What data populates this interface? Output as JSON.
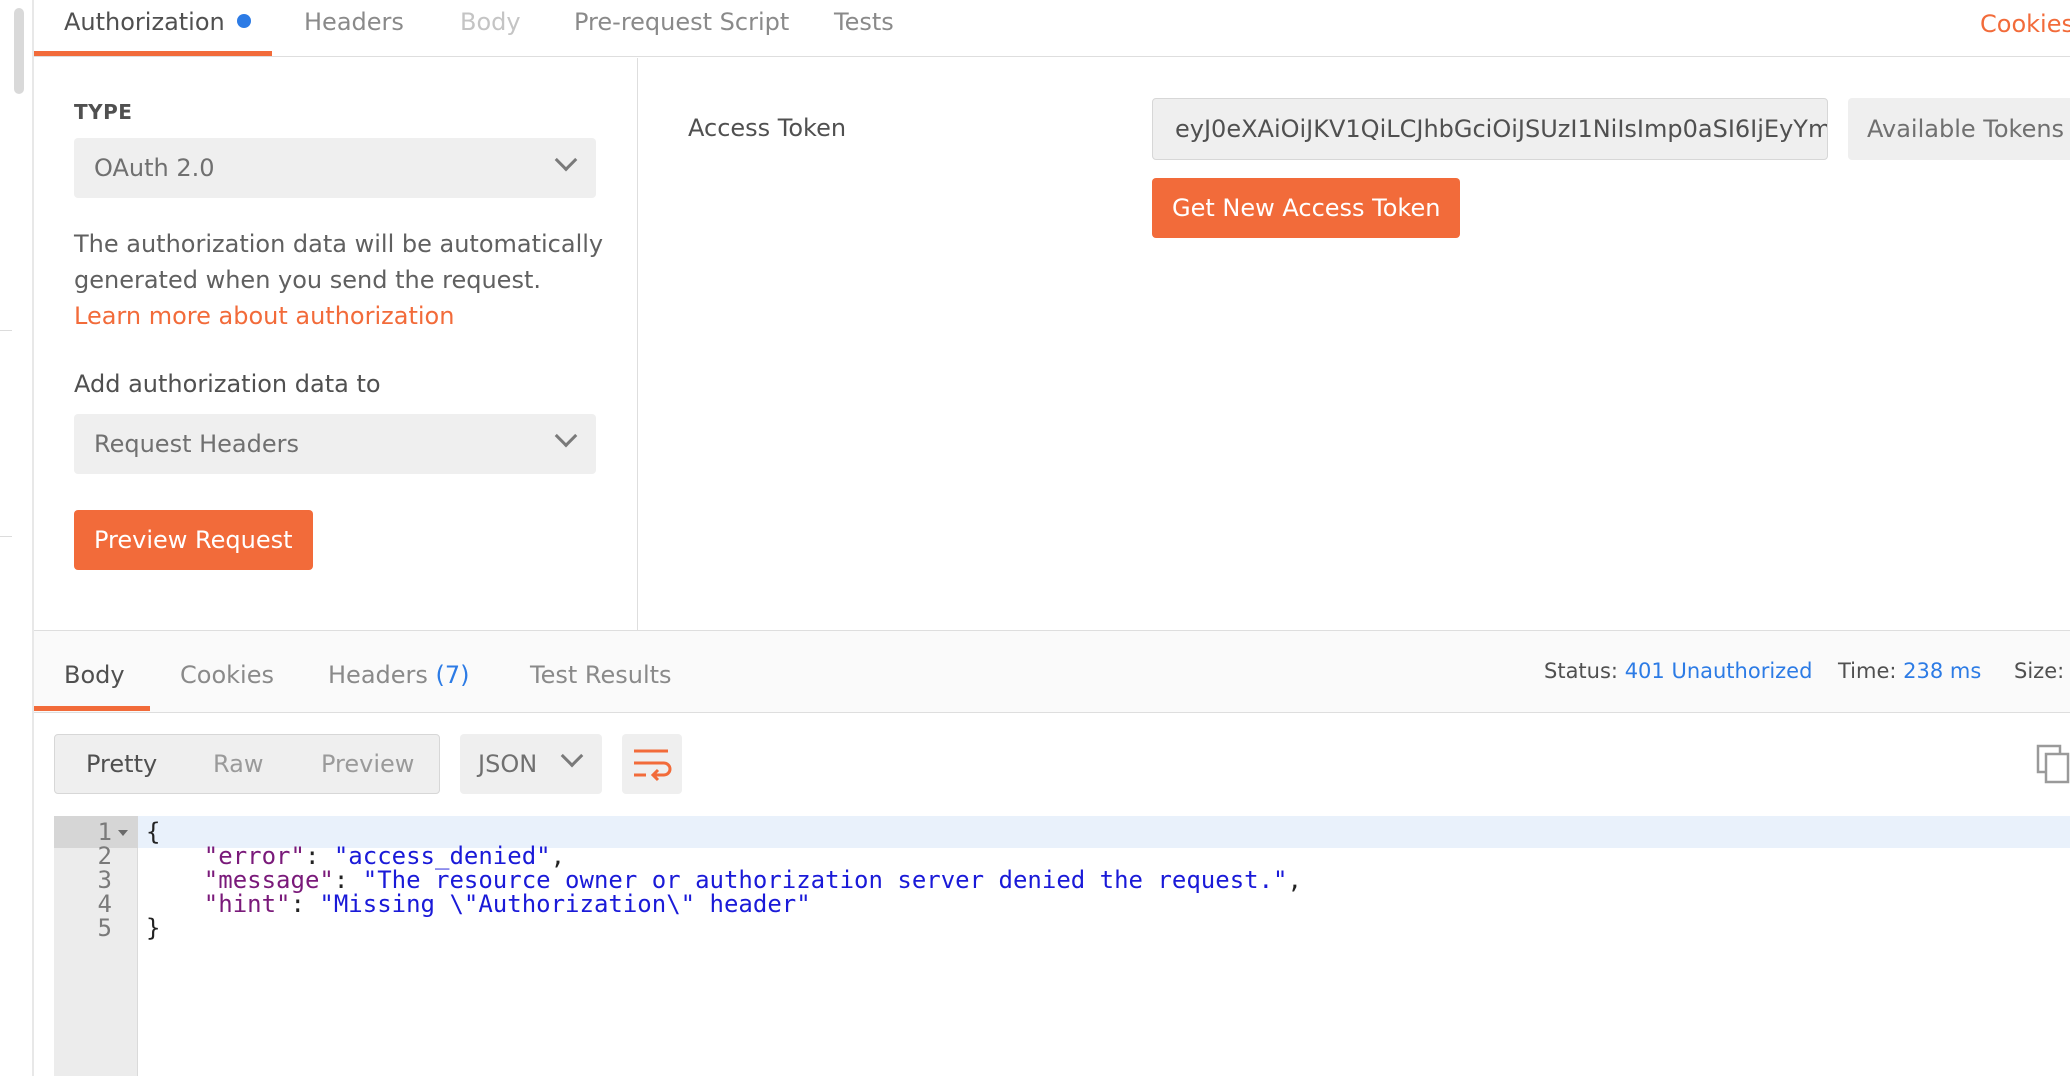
{
  "request_tabs": {
    "authorization": "Authorization",
    "headers": "Headers",
    "body": "Body",
    "pre_request": "Pre-request Script",
    "tests": "Tests",
    "cookies": "Cookies"
  },
  "auth": {
    "type_label": "TYPE",
    "type_value": "OAuth 2.0",
    "description": "The authorization data will be automatically generated when you send the request. ",
    "learn_more": "Learn more about authorization",
    "add_to_label": "Add authorization data to",
    "add_to_value": "Request Headers",
    "preview_button": "Preview Request",
    "access_token_label": "Access Token",
    "access_token_value": "eyJ0eXAiOiJKV1QiLCJhbGciOiJSUzI1NiIsImp0aSI6IjEyYm...",
    "available_tokens": "Available Tokens",
    "get_new_token": "Get New Access Token"
  },
  "response_tabs": {
    "body": "Body",
    "cookies": "Cookies",
    "headers": "Headers",
    "headers_count": "(7)",
    "test_results": "Test Results"
  },
  "status": {
    "status_label": "Status:",
    "status_value": "401 Unauthorized",
    "time_label": "Time:",
    "time_value": "238 ms",
    "size_label": "Size:"
  },
  "view": {
    "pretty": "Pretty",
    "raw": "Raw",
    "preview": "Preview",
    "format": "JSON"
  },
  "code": {
    "line_numbers": [
      "1",
      "2",
      "3",
      "4",
      "5"
    ],
    "open_brace": "{",
    "close_brace": "}",
    "error_key": "\"error\"",
    "error_value": "\"access_denied\"",
    "message_key": "\"message\"",
    "message_value": "\"The resource owner or authorization server denied the request.\"",
    "hint_key": "\"hint\"",
    "hint_value": "\"Missing \\\"Authorization\\\" header\""
  },
  "colors": {
    "accent": "#f26b3a",
    "link_blue": "#2c7be5",
    "json_key": "#7a1a7a",
    "json_string": "#1a1ad8"
  }
}
